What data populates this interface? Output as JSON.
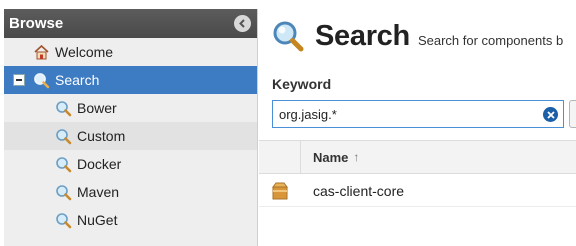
{
  "sidebar": {
    "title": "Browse",
    "items": [
      {
        "label": "Welcome",
        "icon": "home-icon"
      },
      {
        "label": "Search",
        "icon": "magnifier-icon",
        "selected": true,
        "expanded": true
      },
      {
        "label": "Bower",
        "icon": "magnifier-icon"
      },
      {
        "label": "Custom",
        "icon": "magnifier-icon"
      },
      {
        "label": "Docker",
        "icon": "magnifier-icon"
      },
      {
        "label": "Maven",
        "icon": "magnifier-icon"
      },
      {
        "label": "NuGet",
        "icon": "magnifier-icon"
      }
    ]
  },
  "main": {
    "title": "Search",
    "subtitle": "Search for components b",
    "keyword_label": "Keyword",
    "keyword_value": "org.jasig.*",
    "grid": {
      "columns": [
        "Name"
      ],
      "sort_indicator": "↑",
      "rows": [
        {
          "name": "cas-client-core",
          "icon": "component-box-icon"
        }
      ]
    }
  },
  "colors": {
    "selected_bg": "#3d7bc3",
    "header_bg": "#4f4f4f",
    "input_border": "#4a90d9",
    "clear_button": "#1a5fa8"
  }
}
